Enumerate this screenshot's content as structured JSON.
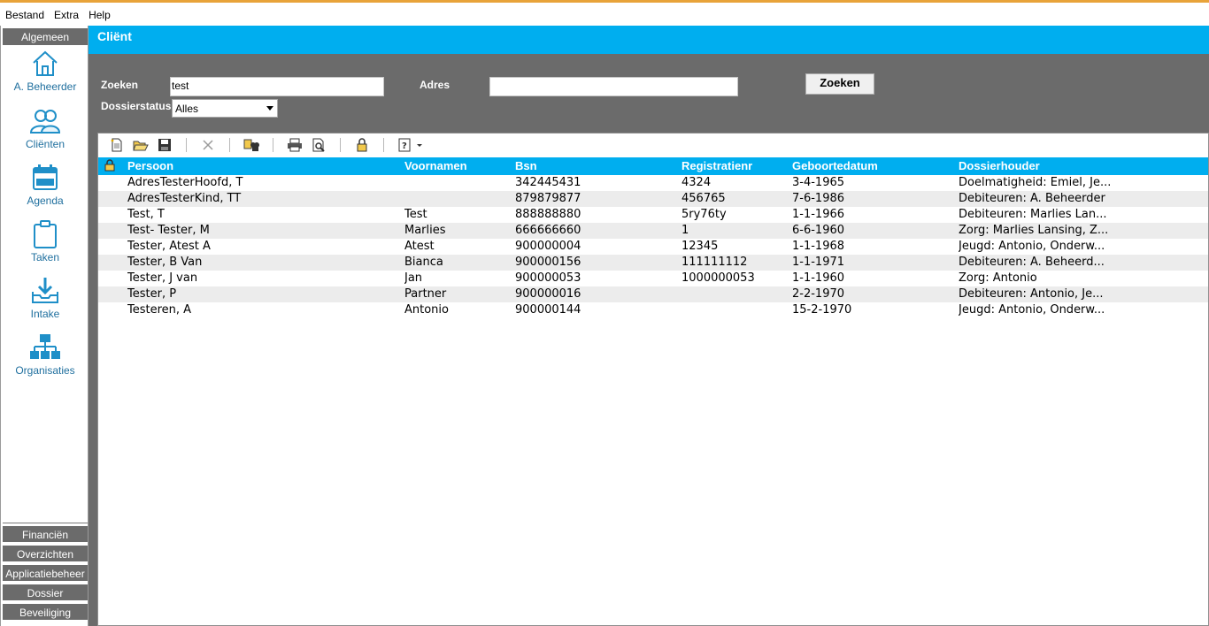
{
  "menubar": {
    "items": [
      {
        "label": "Bestand"
      },
      {
        "label": "Extra"
      },
      {
        "label": "Help"
      }
    ]
  },
  "sidebar": {
    "header": "Algemeen",
    "items": [
      {
        "label": "A. Beheerder",
        "icon": "home-icon"
      },
      {
        "label": "Cliënten",
        "icon": "users-icon"
      },
      {
        "label": "Agenda",
        "icon": "calendar-icon"
      },
      {
        "label": "Taken",
        "icon": "clipboard-icon"
      },
      {
        "label": "Intake",
        "icon": "inbox-download-icon"
      },
      {
        "label": "Organisaties",
        "icon": "organization-icon"
      }
    ],
    "bottom": [
      {
        "label": "Financiën"
      },
      {
        "label": "Overzichten"
      },
      {
        "label": "Applicatiebeheer"
      },
      {
        "label": "Dossier"
      },
      {
        "label": "Beveiliging"
      }
    ]
  },
  "page": {
    "title": "Cliënt"
  },
  "search": {
    "zoeken_label": "Zoeken",
    "zoeken_value": "test",
    "adres_label": "Adres",
    "adres_value": "",
    "dossierstatus_label": "Dossierstatus",
    "dossierstatus_value": "Alles",
    "button_label": "Zoeken"
  },
  "toolbar": {
    "icons": [
      "new-document-icon",
      "open-folder-icon",
      "save-icon",
      "delete-icon",
      "find-replace-icon",
      "print-icon",
      "print-preview-icon",
      "lock-icon",
      "help-icon"
    ]
  },
  "table": {
    "headers": {
      "persoon": "Persoon",
      "voornamen": "Voornamen",
      "bsn": "Bsn",
      "registratienr": "Registratienr",
      "geboortedatum": "Geboortedatum",
      "dossierhouder": "Dossierhouder"
    },
    "rows": [
      {
        "persoon": "AdresTesterHoofd, T",
        "voornamen": "",
        "bsn": "342445431",
        "registratienr": "4324",
        "geboortedatum": "3-4-1965",
        "dossierhouder": "Doelmatigheid: Emiel, Je..."
      },
      {
        "persoon": "AdresTesterKind, TT",
        "voornamen": "",
        "bsn": "879879877",
        "registratienr": "456765",
        "geboortedatum": "7-6-1986",
        "dossierhouder": "Debiteuren: A. Beheerder"
      },
      {
        "persoon": "Test, T",
        "voornamen": "Test",
        "bsn": "888888880",
        "registratienr": "5ry76ty",
        "geboortedatum": "1-1-1966",
        "dossierhouder": "Debiteuren: Marlies Lan..."
      },
      {
        "persoon": "Test- Tester, M",
        "voornamen": "Marlies",
        "bsn": "666666660",
        "registratienr": "1",
        "geboortedatum": "6-6-1960",
        "dossierhouder": "Zorg: Marlies Lansing, Z..."
      },
      {
        "persoon": "Tester, Atest A",
        "voornamen": "Atest",
        "bsn": "900000004",
        "registratienr": "12345",
        "geboortedatum": "1-1-1968",
        "dossierhouder": "Jeugd: Antonio, Onderw..."
      },
      {
        "persoon": "Tester, B Van",
        "voornamen": "Bianca",
        "bsn": "900000156",
        "registratienr": "111111112",
        "geboortedatum": "1-1-1971",
        "dossierhouder": "Debiteuren: A. Beheerd..."
      },
      {
        "persoon": "Tester, J van",
        "voornamen": "Jan",
        "bsn": "900000053",
        "registratienr": "1000000053",
        "geboortedatum": "1-1-1960",
        "dossierhouder": "Zorg: Antonio"
      },
      {
        "persoon": "Tester, P",
        "voornamen": "Partner",
        "bsn": "900000016",
        "registratienr": "",
        "geboortedatum": "2-2-1970",
        "dossierhouder": "Debiteuren: Antonio, Je..."
      },
      {
        "persoon": "Testeren, A",
        "voornamen": "Antonio",
        "bsn": "900000144",
        "registratienr": "",
        "geboortedatum": "15-2-1970",
        "dossierhouder": "Jeugd: Antonio, Onderw..."
      }
    ]
  },
  "colors": {
    "accent": "#00aeef",
    "panel": "#6b6b6b",
    "icon": "#1f8fc8"
  }
}
